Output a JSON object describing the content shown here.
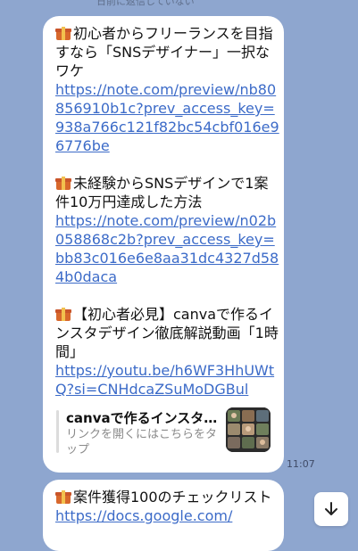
{
  "header_note": "日前に返信していない",
  "messages": [
    {
      "blocks": [
        {
          "title": "初心者からフリーランスを目指すなら「SNSデザイナー」一択なワケ",
          "url": "https://note.com/preview/nb80856910b1c?prev_access_key=938a766c121f82bc54cbf016e96776be"
        },
        {
          "title": "未経験からSNSデザインで1案件10万円達成した方法",
          "url": "https://note.com/preview/n02b058868c2b?prev_access_key=bb83c016e6e8aa31dc4327d584b0daca"
        },
        {
          "title": "【初心者必見】canvaで作るインスタデザイン徹底解説動画「1時間」",
          "url": "https://youtu.be/h6WF3HhUWtQ?si=CNHdcaZSuMoDGBul"
        }
      ],
      "preview": {
        "title": "canvaで作るインスタ…",
        "subtitle": "リンクを開くにはこちらをタップ"
      },
      "time": "11:07"
    },
    {
      "blocks": [
        {
          "title": "案件獲得100のチェックリスト",
          "url": "https://docs.google.com/"
        }
      ]
    }
  ],
  "icons": {
    "gift": "gift-icon",
    "scroll_down": "arrow-down-icon"
  },
  "colors": {
    "background": "#8ea6cf",
    "bubble": "#ffffff",
    "link": "#3c6bc8"
  }
}
